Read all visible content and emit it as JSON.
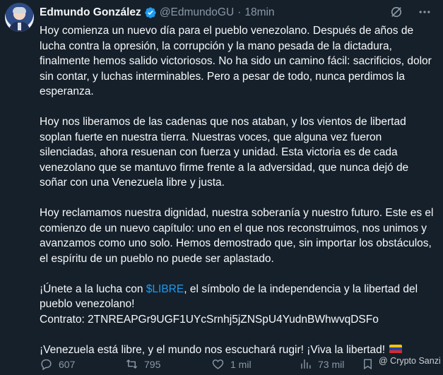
{
  "author": {
    "name": "Edmundo González",
    "handle": "@EdmundoGU",
    "separator": "·",
    "time": "18min"
  },
  "tweet": {
    "p1": "Hoy comienza un nuevo día para el pueblo venezolano. Después de años de lucha contra la opresión, la corrupción y la mano pesada de la dictadura, finalmente hemos salido victoriosos. No ha sido un camino fácil: sacrificios, dolor sin contar, y luchas interminables. Pero a pesar de todo, nunca perdimos la esperanza.",
    "p2": "Hoy nos liberamos de las cadenas que nos ataban, y los vientos de libertad soplan fuerte en nuestra tierra. Nuestras voces, que alguna vez fueron silenciadas, ahora resuenan con fuerza y unidad. Esta victoria es de cada venezolano que se mantuvo firme frente a la adversidad, que nunca dejó de soñar con una Venezuela libre y justa.",
    "p3": "Hoy reclamamos nuestra dignidad, nuestra soberanía y nuestro futuro. Este es el comienzo de un nuevo capítulo: uno en el que nos reconstruimos, nos unimos y avanzamos como uno solo. Hemos demostrado que, sin importar los obstáculos, el espíritu de un pueblo no puede ser aplastado.",
    "p4_before": "¡Únete a la lucha con ",
    "p4_cashtag": "$LIBRE",
    "p4_after": ", el símbolo de la independencia y la libertad del pueblo venezolano!",
    "contract": "Contrato: 2TNREAPGr9UGF1UYcSrnhj5jZNSpU4YudnBWhwvqDSFo",
    "p5": "¡Venezuela está libre, y el mundo nos escuchará rugir! ¡Viva la libertad!",
    "flag_icon": "venezuela-flag-emoji"
  },
  "actions": {
    "replies": "607",
    "retweets": "795",
    "likes": "1 mil",
    "views": "73 mil"
  },
  "watermark": "@ Crypto Sanzi",
  "colors": {
    "background": "#15202b",
    "text": "#f7f9f9",
    "muted": "#8b98a5",
    "accent": "#1d9bf0"
  }
}
